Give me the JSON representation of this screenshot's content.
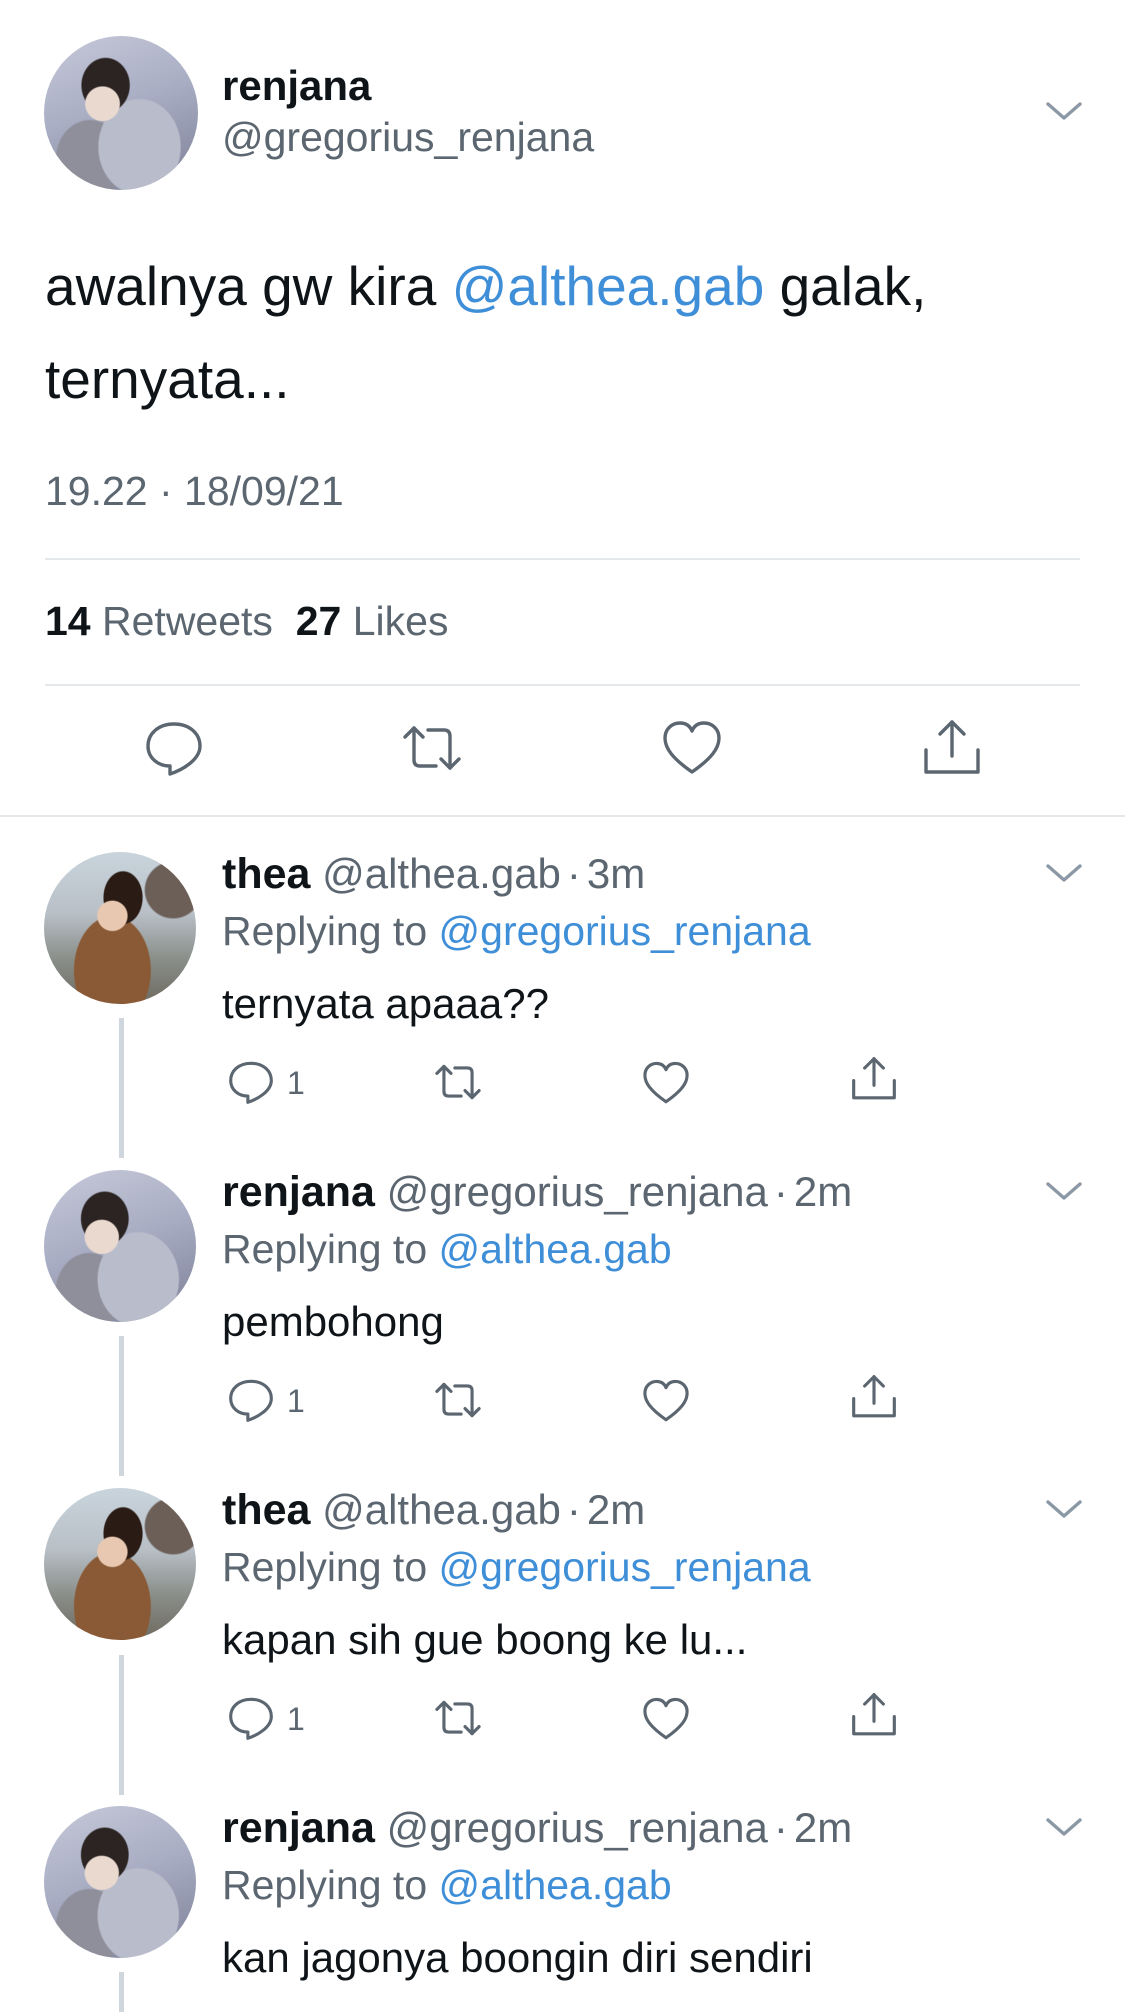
{
  "main_tweet": {
    "display_name": "renjana",
    "handle": "@gregorius_renjana",
    "text_before": "awalnya gw kira ",
    "mention": "@althea.gab",
    "text_after": " galak,",
    "text_line2": "ternyata...",
    "timestamp": "19.22 · 18/09/21",
    "retweets_count": "14",
    "retweets_label": "Retweets",
    "likes_count": "27",
    "likes_label": "Likes"
  },
  "replies": [
    {
      "display_name": "thea",
      "handle": "@althea.gab",
      "sep": "·",
      "time": "3m",
      "replying_label": "Replying to ",
      "replying_to": "@gregorius_renjana",
      "text": "ternyata apaaa??",
      "reply_count": "1",
      "avatar": "thea-avatar"
    },
    {
      "display_name": "renjana",
      "handle": "@gregorius_renjana",
      "sep": "·",
      "time": "2m",
      "replying_label": "Replying to ",
      "replying_to": "@althea.gab",
      "text": "pembohong",
      "reply_count": "1",
      "avatar": "renjana-avatar"
    },
    {
      "display_name": "thea",
      "handle": "@althea.gab",
      "sep": "·",
      "time": "2m",
      "replying_label": "Replying to ",
      "replying_to": "@gregorius_renjana",
      "text": "kapan sih gue boong ke lu...",
      "reply_count": "1",
      "avatar": "thea-avatar"
    },
    {
      "display_name": "renjana",
      "handle": "@gregorius_renjana",
      "sep": "·",
      "time": "2m",
      "replying_label": "Replying to ",
      "replying_to": "@althea.gab",
      "text": "kan jagonya boongin diri sendiri",
      "avatar": "renjana-avatar"
    }
  ],
  "icons": {
    "reply": "reply-icon",
    "retweet": "retweet-icon",
    "like": "heart-icon",
    "share": "share-icon",
    "more": "chevron-down-icon"
  },
  "colors": {
    "link": "#3f8ed8",
    "muted": "#5b6670",
    "divider": "#e4e8eb",
    "thread_line": "#cfd6dd"
  }
}
